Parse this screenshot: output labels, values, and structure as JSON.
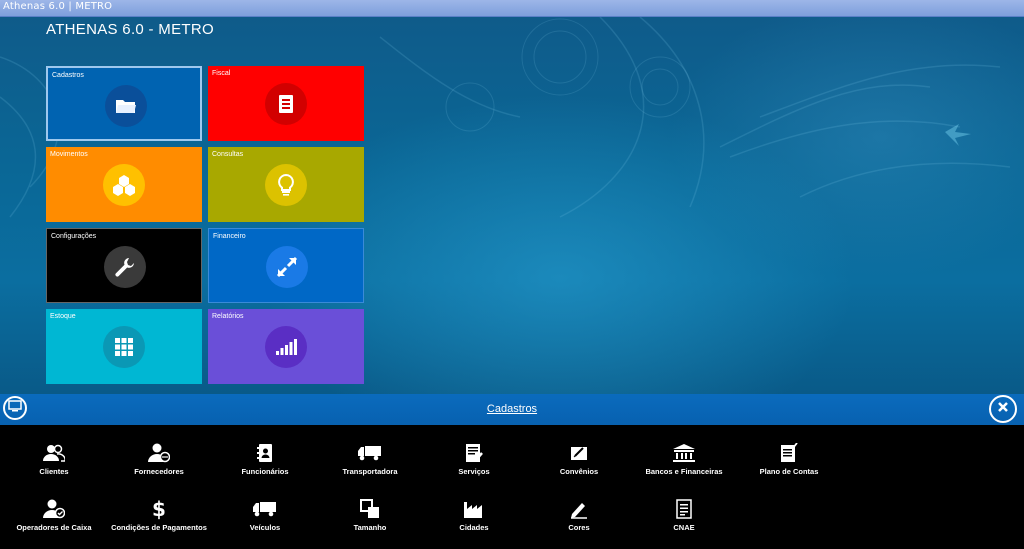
{
  "window": {
    "title": "Athenas 6.0 | METRO"
  },
  "app": {
    "title": "ATHENAS 6.0 - METRO"
  },
  "tiles": [
    {
      "label": "Cadastros",
      "color": "#0063b1",
      "circle": "#0a4f9a",
      "icon": "folder-icon"
    },
    {
      "label": "Fiscal",
      "color": "#ff0000",
      "circle": "#d20000",
      "icon": "document-icon"
    },
    {
      "label": "Movimentos",
      "color": "#ff8c00",
      "circle": "#ffc000",
      "icon": "cubes-icon"
    },
    {
      "label": "Consultas",
      "color": "#a8a800",
      "circle": "#dcc200",
      "icon": "lightbulb-icon"
    },
    {
      "label": "Configurações",
      "color": "#000000",
      "circle": "#3a3a3a",
      "icon": "wrench-icon"
    },
    {
      "label": "Financeiro",
      "color": "#0068c6",
      "circle": "#1a7ae6",
      "icon": "exchange-icon"
    },
    {
      "label": "Estoque",
      "color": "#00b7d3",
      "circle": "#0a98b5",
      "icon": "grid-icon"
    },
    {
      "label": "Relatórios",
      "color": "#6a4fd8",
      "circle": "#5a2ec4",
      "icon": "signal-icon"
    }
  ],
  "section": {
    "title": "Cadastros"
  },
  "items_row1": [
    {
      "label": "Clientes",
      "icon": "users-icon"
    },
    {
      "label": "Fornecedores",
      "icon": "supplier-icon"
    },
    {
      "label": "Funcionários",
      "icon": "contact-book-icon"
    },
    {
      "label": "Transportadora",
      "icon": "truck-icon"
    },
    {
      "label": "Serviços",
      "icon": "service-doc-icon"
    },
    {
      "label": "Convênios",
      "icon": "agreement-icon"
    },
    {
      "label": "Bancos e Financeiras",
      "icon": "bank-icon"
    },
    {
      "label": "Plano de Contas",
      "icon": "checklist-icon"
    }
  ],
  "items_row2": [
    {
      "label": "Operadores de Caixa",
      "icon": "operator-icon"
    },
    {
      "label": "Condições de Pagamentos",
      "icon": "dollar-icon"
    },
    {
      "label": "Veículos",
      "icon": "vehicle-icon"
    },
    {
      "label": "Tamanho",
      "icon": "resize-icon"
    },
    {
      "label": "Cidades",
      "icon": "factory-icon"
    },
    {
      "label": "Cores",
      "icon": "pen-icon"
    },
    {
      "label": "CNAE",
      "icon": "list-doc-icon"
    }
  ]
}
